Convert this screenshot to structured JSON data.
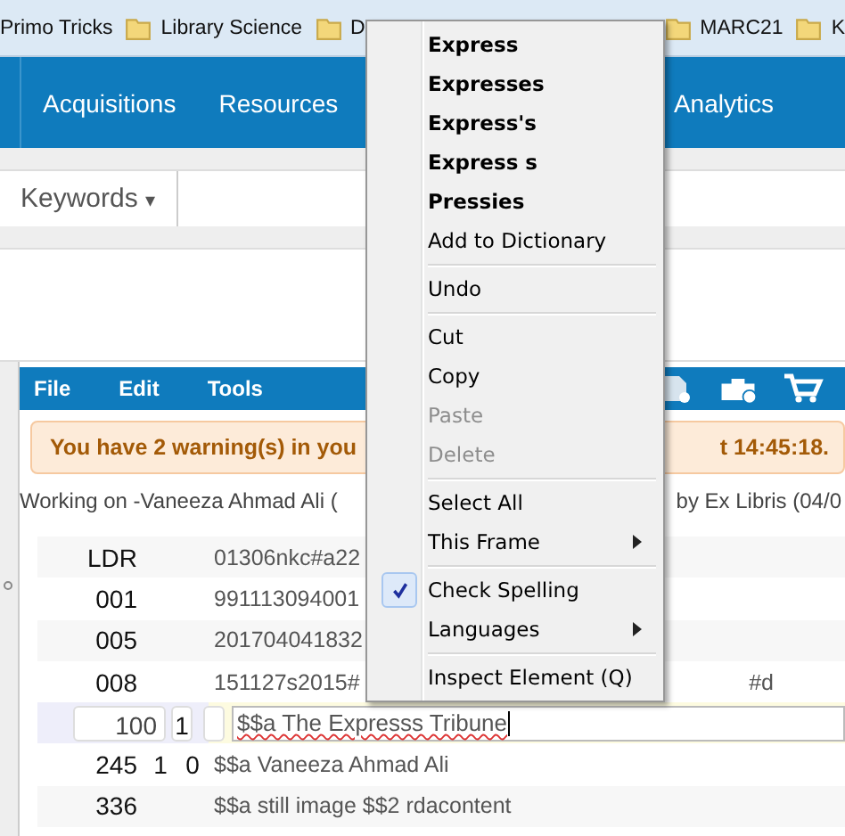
{
  "bookmarks": [
    {
      "label": "Primo Tricks",
      "folder": false
    },
    {
      "label": "Library Science",
      "folder": true
    },
    {
      "label": "D",
      "folder": true
    },
    {
      "label": "MARC21",
      "folder": true
    },
    {
      "label": "K",
      "folder": true
    }
  ],
  "nav": [
    "Acquisitions",
    "Resources",
    "Analytics"
  ],
  "search": {
    "scope": "Keywords",
    "caret": "▾"
  },
  "editor": {
    "menus": [
      "File",
      "Edit",
      "Tools"
    ],
    "warning": {
      "left": "You have 2 warning(s) in you",
      "right": "t 14:45:18."
    },
    "working": {
      "left": "Working on -Vaneeza Ahmad Ali (",
      "right": "by Ex Libris (04/0"
    },
    "rows": [
      {
        "tag": "LDR",
        "ind1": "",
        "ind2": "",
        "value": "01306nkc#a22",
        "tail": "",
        "editing": false
      },
      {
        "tag": "001",
        "ind1": "",
        "ind2": "",
        "value": "991113094001",
        "tail": "",
        "editing": false
      },
      {
        "tag": "005",
        "ind1": "",
        "ind2": "",
        "value": "201704041832",
        "tail": "",
        "editing": false
      },
      {
        "tag": "008",
        "ind1": "",
        "ind2": "",
        "value": "151127s2015#",
        "tail": "#d",
        "editing": false
      },
      {
        "tag": "100",
        "ind1": "1",
        "ind2": "",
        "value": "$$a The Expresss Tribune",
        "tail": "",
        "editing": true
      },
      {
        "tag": "245",
        "ind1": "1",
        "ind2": "0",
        "value": "$$a Vaneeza Ahmad Ali",
        "tail": "",
        "editing": false
      },
      {
        "tag": "336",
        "ind1": "",
        "ind2": "",
        "value": "$$a still image $$2 rdacontent",
        "tail": "",
        "editing": false
      }
    ]
  },
  "context_menu": [
    {
      "kind": "suggestion",
      "label": "Express"
    },
    {
      "kind": "suggestion",
      "label": "Expresses"
    },
    {
      "kind": "suggestion",
      "label": "Express's"
    },
    {
      "kind": "suggestion",
      "label": "Express s"
    },
    {
      "kind": "suggestion",
      "label": "Pressies"
    },
    {
      "kind": "item",
      "label": "Add to Dictionary",
      "disabled": false,
      "checked": false,
      "submenu": false
    },
    {
      "kind": "separator"
    },
    {
      "kind": "item",
      "label": "Undo",
      "disabled": false,
      "checked": false,
      "submenu": false
    },
    {
      "kind": "separator"
    },
    {
      "kind": "item",
      "label": "Cut",
      "disabled": false,
      "checked": false,
      "submenu": false
    },
    {
      "kind": "item",
      "label": "Copy",
      "disabled": false,
      "checked": false,
      "submenu": false
    },
    {
      "kind": "item",
      "label": "Paste",
      "disabled": true,
      "checked": false,
      "submenu": false
    },
    {
      "kind": "item",
      "label": "Delete",
      "disabled": true,
      "checked": false,
      "submenu": false
    },
    {
      "kind": "separator"
    },
    {
      "kind": "item",
      "label": "Select All",
      "disabled": false,
      "checked": false,
      "submenu": false
    },
    {
      "kind": "item",
      "label": "This Frame",
      "disabled": false,
      "checked": false,
      "submenu": true
    },
    {
      "kind": "separator"
    },
    {
      "kind": "item",
      "label": "Check Spelling",
      "disabled": false,
      "checked": true,
      "submenu": false
    },
    {
      "kind": "item",
      "label": "Languages",
      "disabled": false,
      "checked": false,
      "submenu": true
    },
    {
      "kind": "separator"
    },
    {
      "kind": "item",
      "label": "Inspect Element (Q)",
      "disabled": false,
      "checked": false,
      "submenu": false
    }
  ]
}
